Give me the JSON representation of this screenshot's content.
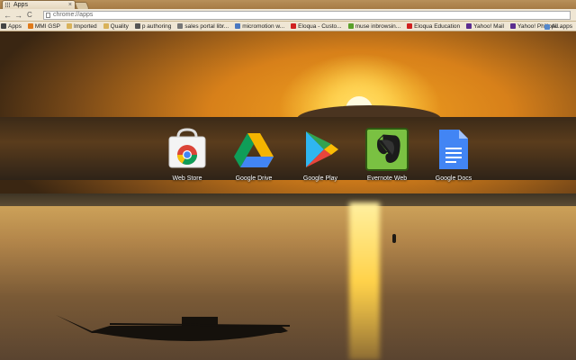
{
  "window": {
    "tab_title": "Apps",
    "tab_close": "×"
  },
  "toolbar": {
    "back": "←",
    "forward": "→",
    "reload": "C",
    "url": "chrome://apps"
  },
  "bookmarks": {
    "items": [
      {
        "label": "Apps",
        "icon": "apps-grid-icon",
        "color": "#444444"
      },
      {
        "label": "MMI GSP",
        "icon": "mmi-icon",
        "color": "#e07a1a"
      },
      {
        "label": "Imported",
        "icon": "folder-icon",
        "color": "#d9b25a"
      },
      {
        "label": "Quality",
        "icon": "folder-icon",
        "color": "#d9b25a"
      },
      {
        "label": "p authoring",
        "icon": "bookmark-icon",
        "color": "#555555"
      },
      {
        "label": "sales portal libr...",
        "icon": "page-icon",
        "color": "#777777"
      },
      {
        "label": "micromotion w...",
        "icon": "page-icon",
        "color": "#4a78c0"
      },
      {
        "label": "Eloqua - Custo...",
        "icon": "eloqua-icon",
        "color": "#d02020"
      },
      {
        "label": "muse inbrowsin...",
        "icon": "muse-icon",
        "color": "#5aa02a"
      },
      {
        "label": "Eloqua Education",
        "icon": "eloqua-icon",
        "color": "#d02020"
      },
      {
        "label": "Yahoo! Mail",
        "icon": "yahoo-icon",
        "color": "#5b2d90"
      },
      {
        "label": "Yahoo! Philippi...",
        "icon": "yahoo-icon",
        "color": "#5b2d90"
      }
    ],
    "all_label": "All apps"
  },
  "apps": [
    {
      "label": "Web Store",
      "icon": "chrome-web-store-icon"
    },
    {
      "label": "Google Drive",
      "icon": "google-drive-icon"
    },
    {
      "label": "Google Play",
      "icon": "google-play-icon"
    },
    {
      "label": "Evernote Web",
      "icon": "evernote-icon"
    },
    {
      "label": "Google Docs",
      "icon": "google-docs-icon"
    }
  ]
}
